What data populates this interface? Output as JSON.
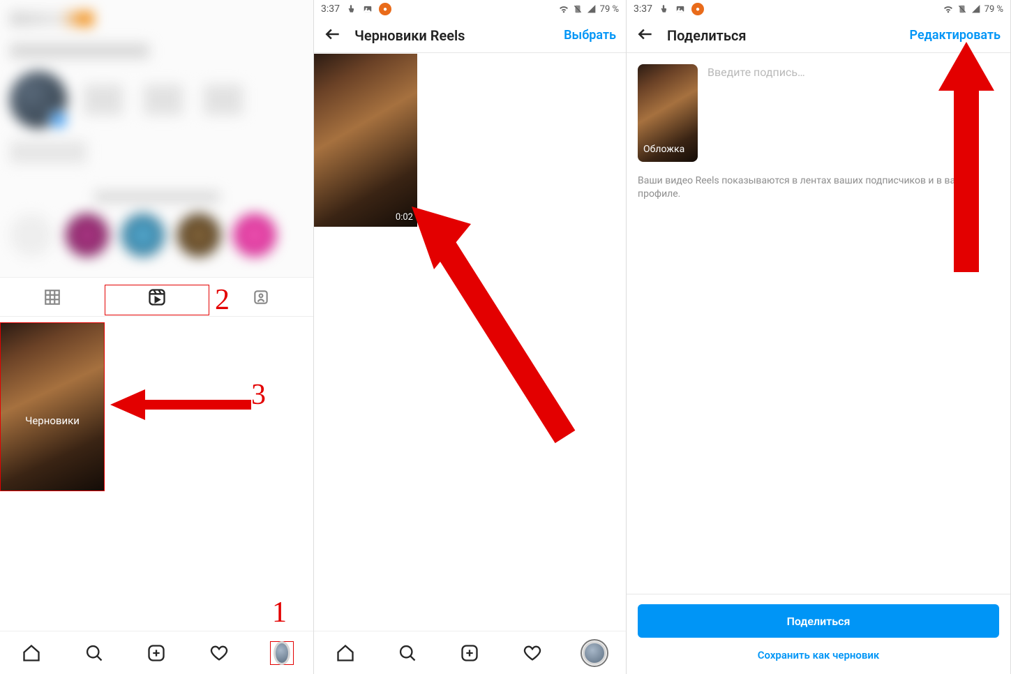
{
  "status": {
    "time": "3:37",
    "battery": "79 %",
    "icons": {
      "touch": "touch-icon",
      "photo": "photo-icon",
      "orange": "orange-dot",
      "wifi": "wifi-icon",
      "sim": "sim-icon",
      "signal": "signal-icon"
    }
  },
  "panel1": {
    "tabs": {
      "grid": "grid-icon",
      "reels": "reels-icon",
      "tagged": "tagged-icon"
    },
    "draft_label": "Черновики",
    "annotations": {
      "num1": "1",
      "num2": "2",
      "num3": "3"
    },
    "nav": {
      "home": "home-icon",
      "search": "search-icon",
      "create": "create-icon",
      "activity": "heart-icon",
      "profile": "profile-avatar"
    }
  },
  "panel2": {
    "header": {
      "title": "Черновики Reels",
      "action": "Выбрать"
    },
    "draft_duration": "0:02",
    "nav": {
      "home": "home-icon",
      "search": "search-icon",
      "create": "create-icon",
      "activity": "heart-icon",
      "profile": "profile-avatar"
    }
  },
  "panel3": {
    "header": {
      "title": "Поделиться",
      "action": "Редактировать"
    },
    "cover_label": "Обложка",
    "caption_placeholder": "Введите подпись…",
    "info_text": "Ваши видео Reels показываются в лентах ваших подписчиков и в вашем профиле.",
    "share_button": "Поделиться",
    "save_draft": "Сохранить как черновик"
  }
}
